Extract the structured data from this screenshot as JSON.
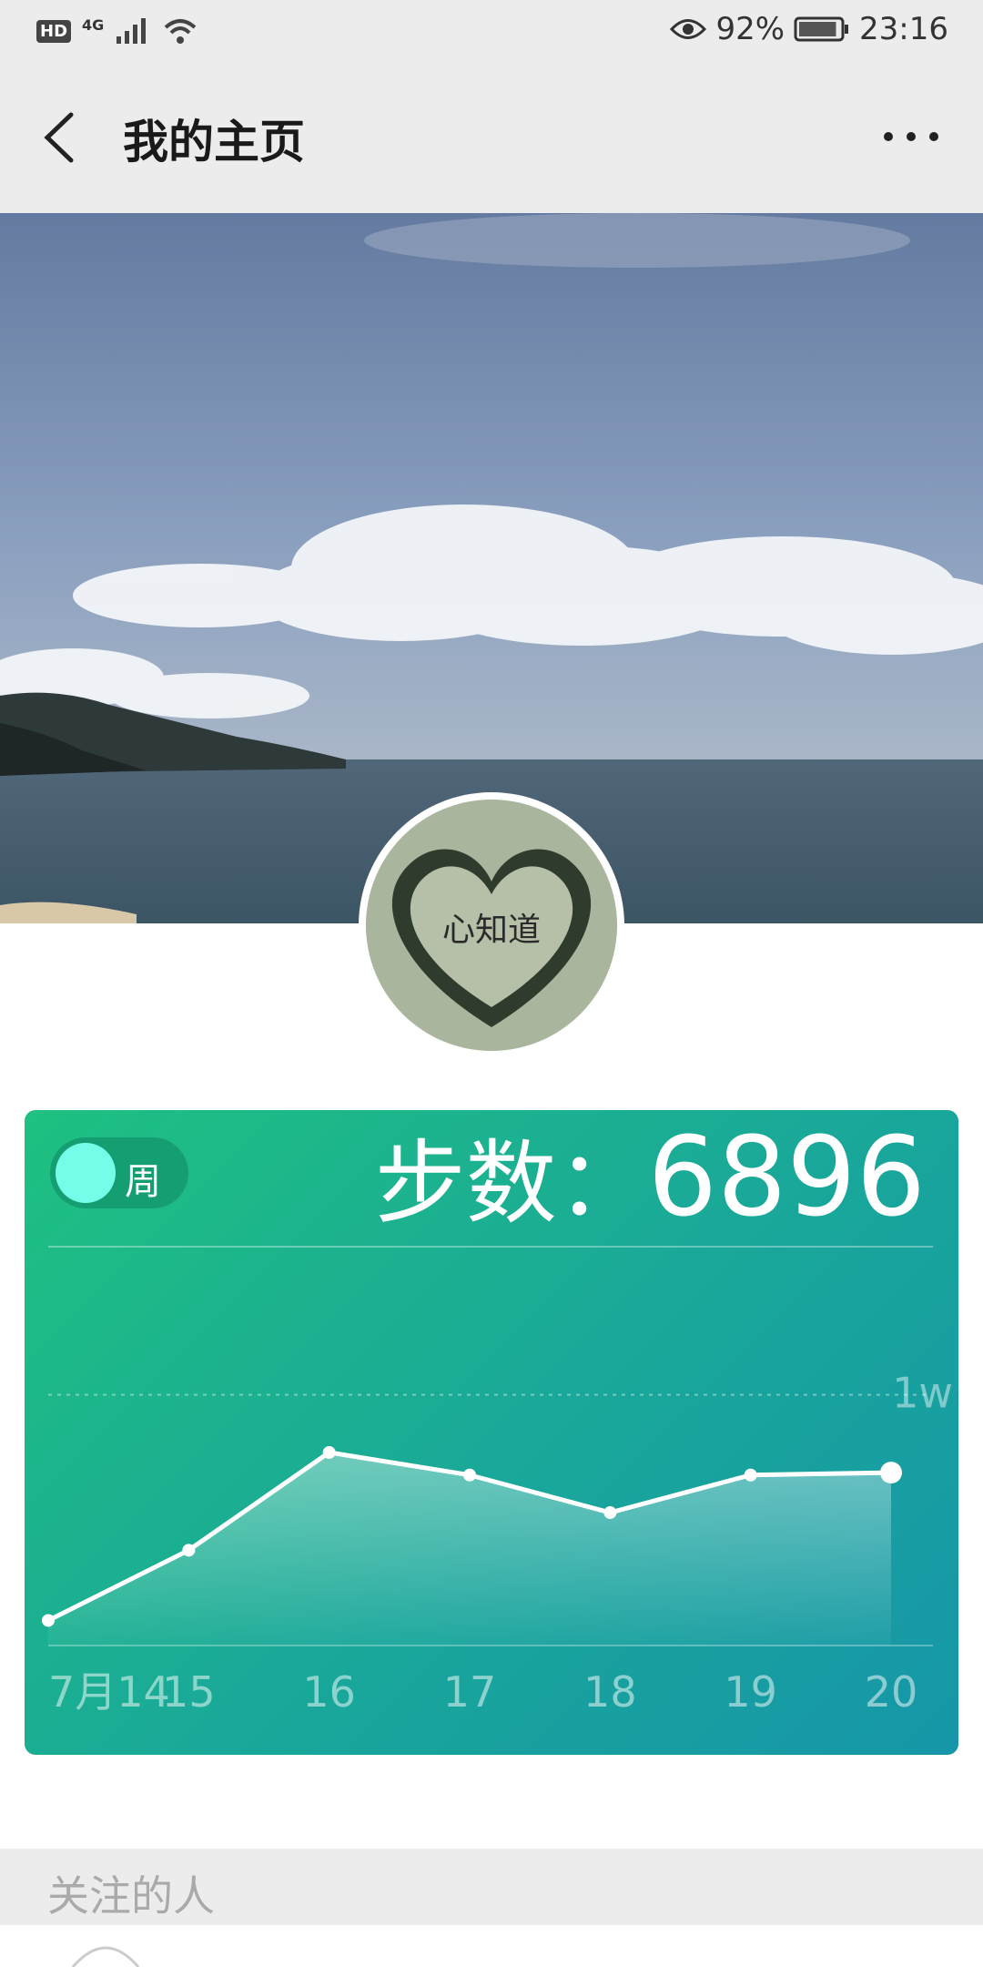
{
  "status_bar": {
    "left_badges": [
      "HD",
      "4G"
    ],
    "eye_icon": "eye-icon",
    "battery_percent": "92%",
    "battery_level": 0.92,
    "time": "23:16"
  },
  "nav": {
    "back_icon": "chevron-left-icon",
    "title": "我的主页",
    "more_icon": "more-horizontal-icon"
  },
  "profile": {
    "avatar_text": "心知道"
  },
  "steps_card": {
    "toggle_label": "周",
    "steps_label": "步数：",
    "steps_value": "6896",
    "colors": {
      "start": "#1fc081",
      "end": "#1696a8",
      "toggle_knob": "#76fde9"
    }
  },
  "chart_data": {
    "type": "area",
    "x": [
      "7月14",
      "15",
      "16",
      "17",
      "18",
      "19",
      "20"
    ],
    "values": [
      1000,
      3800,
      7700,
      6800,
      5300,
      6800,
      6896
    ],
    "reference_line": {
      "value": 10000,
      "label": "1w"
    },
    "ylim": [
      0,
      13000
    ],
    "grid": false,
    "highlight_index": 6
  },
  "follow": {
    "section_title": "关注的人"
  }
}
